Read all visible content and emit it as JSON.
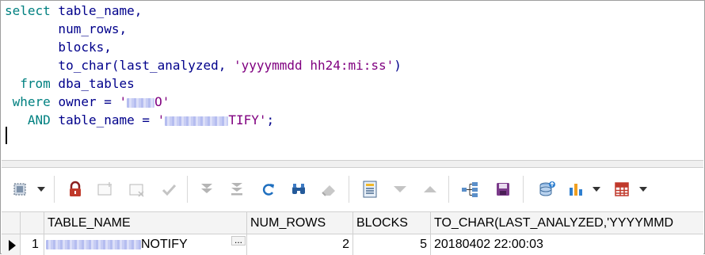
{
  "editor": {
    "lines": [
      {
        "parts": [
          {
            "t": "select",
            "c": "kw"
          },
          {
            "t": " table_name,"
          }
        ]
      },
      {
        "parts": [
          {
            "t": "       num_rows,"
          }
        ]
      },
      {
        "parts": [
          {
            "t": "       blocks,"
          }
        ]
      },
      {
        "parts": [
          {
            "t": "       to_char(last_analyzed, "
          },
          {
            "t": "'yyyymmdd hh24:mi:ss'",
            "c": "str"
          },
          {
            "t": ")"
          }
        ]
      },
      {
        "parts": [
          {
            "t": "  "
          },
          {
            "t": "from",
            "c": "kw"
          },
          {
            "t": " dba_tables"
          }
        ]
      },
      {
        "parts": [
          {
            "t": " "
          },
          {
            "t": "where",
            "c": "kw"
          },
          {
            "t": " owner = "
          },
          {
            "t": "'",
            "c": "str"
          },
          {
            "r": 70
          },
          {
            "t": "O'",
            "c": "str"
          }
        ]
      },
      {
        "parts": [
          {
            "t": "   "
          },
          {
            "t": "AND",
            "c": "kw"
          },
          {
            "t": " table_name = "
          },
          {
            "t": "'",
            "c": "str"
          },
          {
            "r": 160
          },
          {
            "t": "TIFY'",
            "c": "str"
          },
          {
            "t": ";"
          }
        ]
      },
      {
        "parts": [
          {
            "t": ""
          }
        ]
      }
    ]
  },
  "toolbar": {
    "icons": [
      "select-rows-icon",
      "lock-icon",
      "insert-record-icon",
      "delete-record-icon",
      "post-changes-icon",
      "last-record-icon",
      "fetch-all-icon",
      "refresh-icon",
      "find-icon",
      "clear-icon",
      "single-record-view-icon",
      "next-record-icon",
      "previous-record-icon",
      "query-tree-icon",
      "save-icon",
      "export-icon",
      "chart-icon",
      "grid-options-icon"
    ]
  },
  "grid": {
    "columns": [
      "TABLE_NAME",
      "NUM_ROWS",
      "BLOCKS",
      "TO_CHAR(LAST_ANALYZED,'YYYYMMD"
    ],
    "rows": [
      {
        "index": "1",
        "table_name_suffix": "NOTIFY",
        "num_rows": "2",
        "blocks": "5",
        "last_analyzed": "20180402 22:00:03"
      }
    ]
  },
  "colors": {
    "keyword": "#008080",
    "identifier": "#00008b",
    "string": "#800080",
    "lock": "#c0392b",
    "save": "#7b3a8a",
    "grid_icon": "#c0392b"
  }
}
